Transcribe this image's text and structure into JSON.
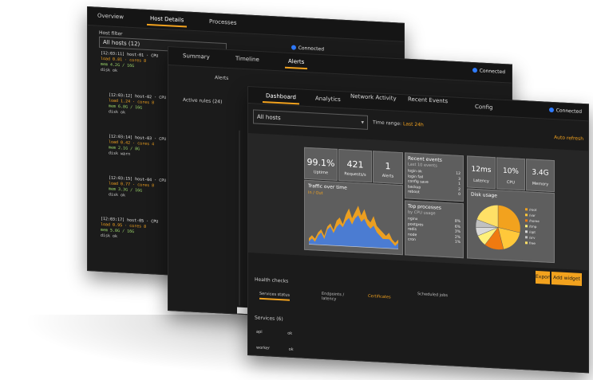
{
  "back_panel": {
    "tabs": [
      {
        "label": "Overview",
        "active": false
      },
      {
        "label": "Host Details",
        "active": true
      },
      {
        "label": "Processes",
        "active": false
      }
    ],
    "status": "Connected",
    "filter_label": "Host filter",
    "select_value": "All hosts (12)",
    "entries": [
      {
        "head": "[12:03:11] host-01 · CPU",
        "lines": [
          "load 0.81 · cores 8",
          "mem 4.2G / 16G",
          "disk ok"
        ]
      },
      {
        "head": "[12:03:12] host-02 · CPU",
        "lines": [
          "load 1.24 · cores 8",
          "mem 6.8G / 16G",
          "disk ok"
        ]
      },
      {
        "head": "[12:03:14] host-03 · CPU",
        "lines": [
          "load 0.42 · cores 4",
          "mem 2.1G / 8G",
          "disk warn"
        ]
      },
      {
        "head": "[12:03:15] host-04 · CPU",
        "lines": [
          "load 0.77 · cores 8",
          "mem 3.3G / 16G",
          "disk ok"
        ]
      },
      {
        "head": "[12:03:17] host-05 · CPU",
        "lines": [
          "load 0.95 · cores 8",
          "mem 5.0G / 16G",
          "disk ok"
        ]
      }
    ]
  },
  "mid_panel": {
    "tabs": [
      {
        "label": "Summary",
        "active": false
      },
      {
        "label": "Timeline",
        "active": false
      },
      {
        "label": "Alerts",
        "active": true
      }
    ],
    "status": "Connected",
    "header": "Alerts",
    "left_label": "Active rules (24)"
  },
  "front_panel": {
    "tabs": [
      {
        "label": "Dashboard",
        "active": true
      },
      {
        "label": "Analytics",
        "active": false
      },
      {
        "label": "Network Activity",
        "active": false
      },
      {
        "label": "Recent Events",
        "active": false
      },
      {
        "label": "Config",
        "active": false
      }
    ],
    "status": "Connected",
    "select_value": "All hosts",
    "time_range_label": "Time range:",
    "time_range_link": "Last 24h",
    "refresh_link": "Auto refresh",
    "stats_left": [
      {
        "value": "99.1%",
        "label": "Uptime"
      },
      {
        "value": "421",
        "label": "Requests/s"
      },
      {
        "value": "1",
        "label": "Alerts"
      }
    ],
    "stats_right": [
      {
        "value": "12ms",
        "label": "Latency"
      },
      {
        "value": "10%",
        "label": "CPU"
      },
      {
        "value": "3.4G",
        "label": "Memory"
      }
    ],
    "throughput_title": "Traffic over time",
    "throughput_legend": "In / Out",
    "events_title": "Recent events",
    "events_subtitle": "Last 10 events",
    "events": [
      {
        "name": "login ok",
        "val": "12"
      },
      {
        "name": "login fail",
        "val": "3"
      },
      {
        "name": "config save",
        "val": "1"
      },
      {
        "name": "backup",
        "val": "2"
      },
      {
        "name": "reboot",
        "val": "0"
      }
    ],
    "top_title": "Top processes",
    "top_subtitle": "by CPU usage",
    "top": [
      {
        "name": "nginx",
        "val": "8%"
      },
      {
        "name": "postgres",
        "val": "6%"
      },
      {
        "name": "redis",
        "val": "3%"
      },
      {
        "name": "node",
        "val": "2%"
      },
      {
        "name": "cron",
        "val": "1%"
      }
    ],
    "pie_title": "Disk usage",
    "pie_legend": [
      "/root",
      "/var",
      "/home",
      "/tmp",
      "/opt",
      "/srv",
      "free"
    ],
    "btn_primary": "Export",
    "btn_secondary": "Add widget",
    "section_title": "Health checks",
    "sub_tabs": [
      {
        "label": "Services status",
        "active": true
      },
      {
        "label": "Endpoints / latency",
        "active": false
      },
      {
        "label": "Certificates",
        "active": false
      },
      {
        "label": "Scheduled jobs",
        "active": false
      }
    ],
    "list_header": "Services (6)",
    "list_rows": [
      {
        "a": "api",
        "b": "ok"
      },
      {
        "a": "worker",
        "b": "ok"
      }
    ]
  },
  "colors": {
    "accent": "#f2a21e",
    "panel_bg": "#1b1b1b",
    "card_bg": "#5e5e5e",
    "link_blue": "#2f7bff"
  },
  "chart_data": [
    {
      "type": "area",
      "title": "Traffic over time",
      "series": [
        {
          "name": "In",
          "values": [
            2,
            3,
            2,
            4,
            5,
            3,
            6,
            7,
            5,
            8,
            9,
            7,
            10,
            12,
            9,
            11,
            13,
            10,
            12,
            9,
            8,
            10,
            7,
            6,
            5,
            4,
            5,
            3,
            2,
            3
          ]
        },
        {
          "name": "Out",
          "values": [
            1,
            2,
            1,
            3,
            4,
            2,
            5,
            6,
            4,
            6,
            7,
            6,
            8,
            9,
            7,
            9,
            10,
            8,
            9,
            7,
            6,
            7,
            5,
            4,
            3,
            3,
            3,
            2,
            1,
            2
          ]
        }
      ]
    },
    {
      "type": "pie",
      "title": "Disk usage",
      "labels": [
        "/root",
        "/var",
        "/home",
        "/tmp",
        "/opt",
        "/srv",
        "free"
      ],
      "values": [
        28,
        18,
        14,
        8,
        6,
        6,
        20
      ]
    }
  ]
}
